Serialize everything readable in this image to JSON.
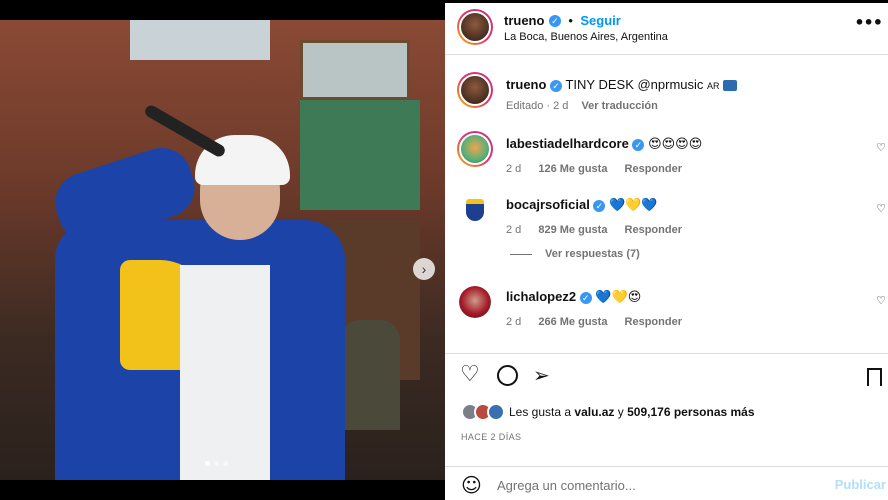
{
  "post": {
    "author": "trueno",
    "follow_label": "Seguir",
    "location": "La Boca, Buenos Aires, Argentina",
    "more_icon": "more-horizontal-icon"
  },
  "caption": {
    "username": "trueno",
    "text": "TINY DESK @nprmusic",
    "flag": "AR",
    "edited": "Editado · 2 d",
    "translate_label": "Ver traducción"
  },
  "comments": [
    {
      "username": "labestiadelhardcore",
      "text": "😍😍😍😍",
      "time": "2 d",
      "likes": "126 Me gusta",
      "reply": "Responder"
    },
    {
      "username": "bocajrsoficial",
      "text": "💙💛💙",
      "time": "2 d",
      "likes": "829 Me gusta",
      "reply": "Responder",
      "view_replies": "Ver respuestas (7)"
    },
    {
      "username": "lichalopez2",
      "text": "💙💛😍",
      "time": "2 d",
      "likes": "266 Me gusta",
      "reply": "Responder"
    }
  ],
  "likes": {
    "prefix": "Les gusta a",
    "user": "valu.az",
    "connector": "y",
    "count": "509,176 personas más"
  },
  "date": "HACE 2 DÍAS",
  "comment_input": {
    "placeholder": "Agrega un comentario...",
    "publish": "Publicar"
  },
  "colors": {
    "link": "#0095f6",
    "verified": "#3897f0",
    "muted": "#737373"
  }
}
